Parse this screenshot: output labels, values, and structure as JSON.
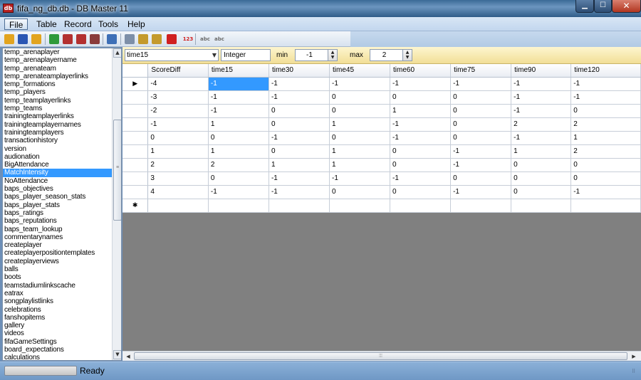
{
  "window": {
    "title": "fifa_ng_db.db - DB Master 11",
    "app_icon_text": "db",
    "min_glyph": "▁",
    "max_glyph": "☐",
    "close_glyph": "✕"
  },
  "menu": {
    "items": [
      "File",
      "Table",
      "Record",
      "Tools",
      "Help"
    ]
  },
  "toolbar": {
    "buttons": [
      {
        "name": "open-icon",
        "color": "#e2a41f"
      },
      {
        "name": "save-icon",
        "color": "#2a56b3"
      },
      {
        "name": "folder-icon",
        "color": "#e2a41f"
      },
      {
        "name": "import-icon",
        "color": "#2f9a3b"
      },
      {
        "name": "export-icon",
        "color": "#b33030"
      },
      {
        "name": "export-all-icon",
        "color": "#b33030"
      },
      {
        "name": "database-icon",
        "color": "#8a3b3b"
      },
      {
        "name": "table-view-icon",
        "color": "#3d6fb7"
      },
      {
        "name": "copy-icon",
        "color": "#7d8fa8"
      },
      {
        "name": "paste-icon",
        "color": "#c49a2c"
      },
      {
        "name": "paste-special-icon",
        "color": "#c49a2c"
      },
      {
        "name": "delete-icon",
        "color": "#d02020"
      },
      {
        "name": "number-format-icon",
        "color": "#d02020"
      },
      {
        "name": "spell-check-icon",
        "color": "#6b6b6b"
      },
      {
        "name": "replace-text-icon",
        "color": "#6b6b6b"
      }
    ],
    "labels": {
      "number_format": "123",
      "spell": "abc",
      "replace": "abc"
    }
  },
  "sidebar": {
    "items": [
      "temp_arenaplayer",
      "temp_arenaplayername",
      "temp_arenateam",
      "temp_arenateamplayerlinks",
      "temp_formations",
      "temp_players",
      "temp_teamplayerlinks",
      "temp_teams",
      "trainingteamplayerlinks",
      "trainingteamplayernames",
      "trainingteamplayers",
      "transactionhistory",
      "version",
      "audionation",
      "BigAttendance",
      "MatchIntensity",
      "NoAttendance",
      "baps_objectives",
      "baps_player_season_stats",
      "baps_player_stats",
      "baps_ratings",
      "baps_reputations",
      "baps_team_lookup",
      "commentarynames",
      "createplayer",
      "createplayerpositiontemplates",
      "createplayerviews",
      "balls",
      "boots",
      "teamstadiumlinkscache",
      "eatrax",
      "songplaylistlinks",
      "celebrations",
      "fanshopitems",
      "gallery",
      "videos",
      "fifaGameSettings",
      "board_expectations",
      "calculations"
    ],
    "selected_index": 15
  },
  "fieldbar": {
    "field": "time15",
    "type": "Integer",
    "min_label": "min",
    "min_value": "-1",
    "max_label": "max",
    "max_value": "2"
  },
  "grid": {
    "columns": [
      "ScoreDiff",
      "time15",
      "time30",
      "time45",
      "time60",
      "time75",
      "time90",
      "time120"
    ],
    "rows": [
      [
        "-4",
        "-1",
        "-1",
        "-1",
        "-1",
        "-1",
        "-1",
        "-1"
      ],
      [
        "-3",
        "-1",
        "-1",
        "0",
        "0",
        "0",
        "-1",
        "-1"
      ],
      [
        "-2",
        "-1",
        "0",
        "0",
        "1",
        "0",
        "-1",
        "0"
      ],
      [
        "-1",
        "1",
        "0",
        "1",
        "-1",
        "0",
        "2",
        "2"
      ],
      [
        "0",
        "0",
        "-1",
        "0",
        "-1",
        "0",
        "-1",
        "1"
      ],
      [
        "1",
        "1",
        "0",
        "1",
        "0",
        "-1",
        "1",
        "2"
      ],
      [
        "2",
        "2",
        "1",
        "1",
        "0",
        "-1",
        "0",
        "0"
      ],
      [
        "3",
        "0",
        "-1",
        "-1",
        "-1",
        "0",
        "0",
        "0"
      ],
      [
        "4",
        "-1",
        "-1",
        "0",
        "0",
        "-1",
        "0",
        "-1"
      ]
    ],
    "current_row_marker": "▶",
    "new_row_marker": "✱",
    "selected_cell": {
      "row": 0,
      "col": 1
    }
  },
  "hscroll": {
    "left_arrow": "◀",
    "right_arrow": "▶",
    "grip": "⦙⦙⦙"
  },
  "status": {
    "text": "Ready"
  },
  "colors": {
    "title_bar": "#3a6a96",
    "selection": "#3399ff",
    "field_bar": "#f2df97",
    "grid_background": "#808080",
    "status_bar": "#7aa2cd"
  }
}
